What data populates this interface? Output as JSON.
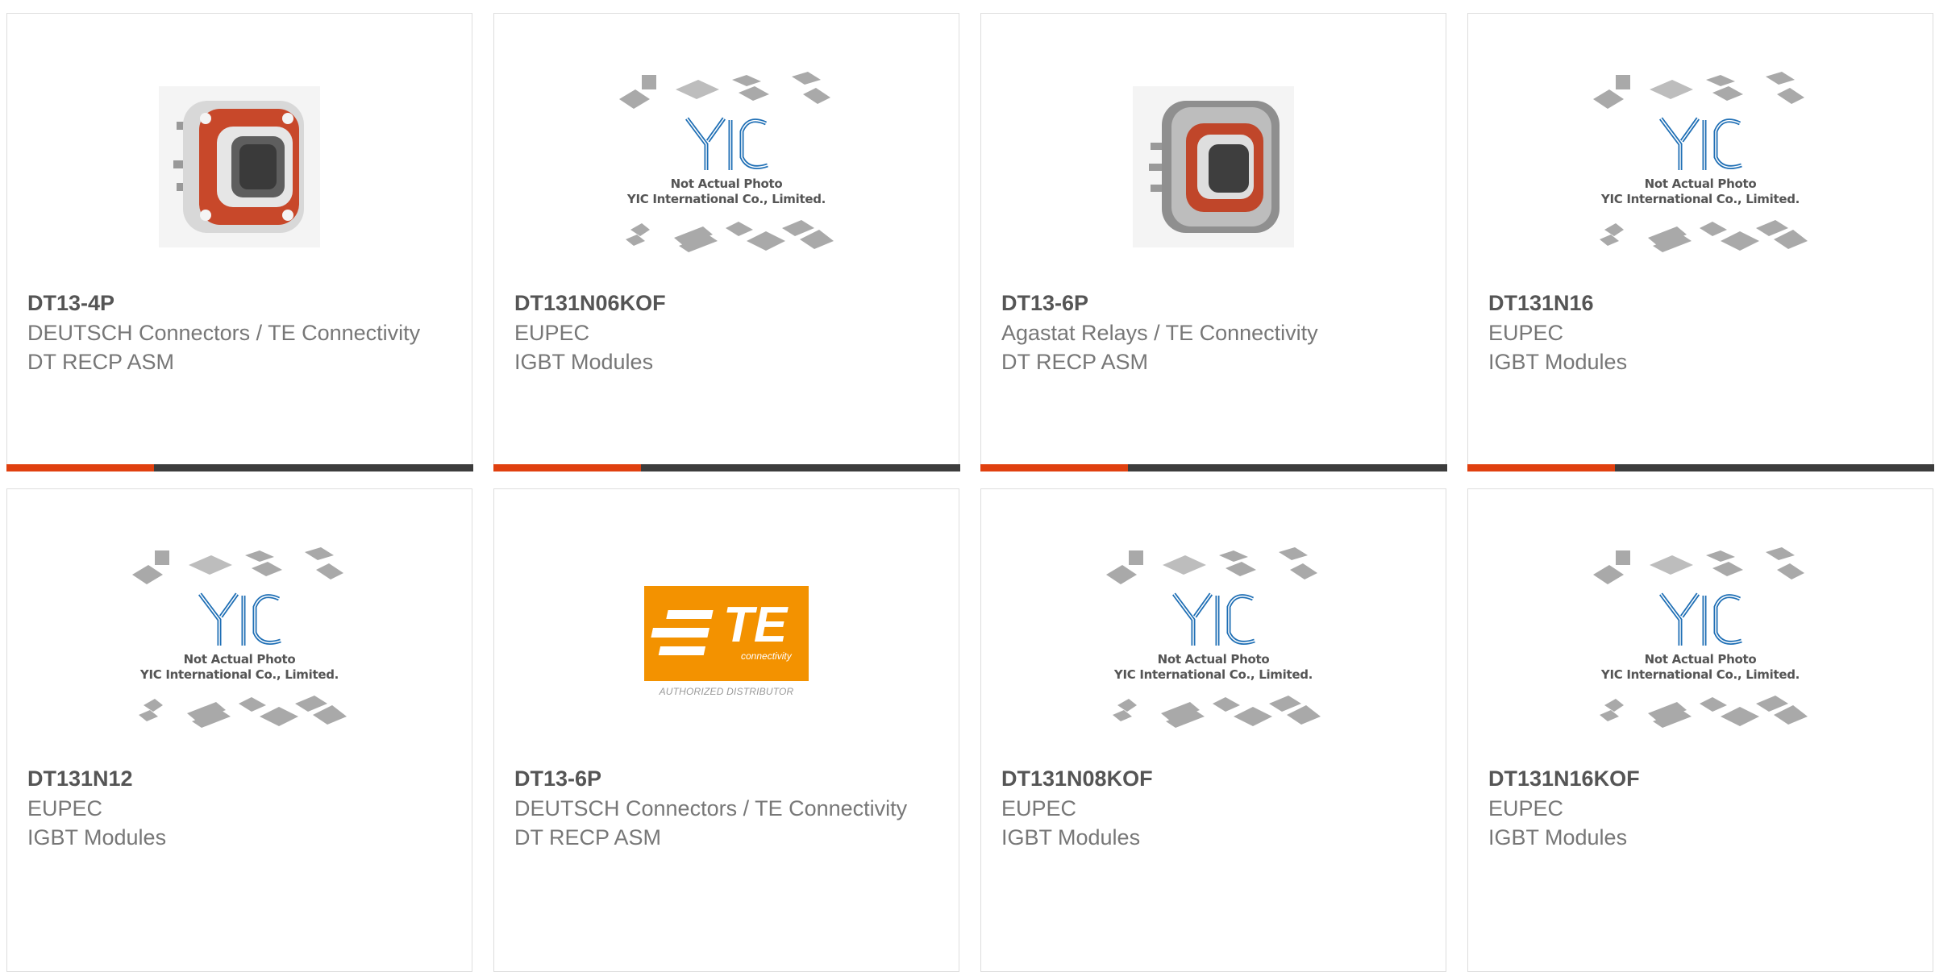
{
  "products": [
    {
      "part_number": "DT13-4P",
      "manufacturer": "DEUTSCH Connectors / TE Connectivity",
      "description": "DT RECP ASM",
      "image": "connector-photo-orange"
    },
    {
      "part_number": "DT131N06KOF",
      "manufacturer": "EUPEC",
      "description": "IGBT Modules",
      "image": "yic-placeholder"
    },
    {
      "part_number": "DT13-6P",
      "manufacturer": "Agastat Relays / TE Connectivity",
      "description": "DT RECP ASM",
      "image": "connector-photo-gray"
    },
    {
      "part_number": "DT131N16",
      "manufacturer": "EUPEC",
      "description": "IGBT Modules",
      "image": "yic-placeholder"
    },
    {
      "part_number": "DT131N12",
      "manufacturer": "EUPEC",
      "description": "IGBT Modules",
      "image": "yic-placeholder"
    },
    {
      "part_number": "DT13-6P",
      "manufacturer": "DEUTSCH Connectors / TE Connectivity",
      "description": "DT RECP ASM",
      "image": "te-connectivity-logo"
    },
    {
      "part_number": "DT131N08KOF",
      "manufacturer": "EUPEC",
      "description": "IGBT Modules",
      "image": "yic-placeholder"
    },
    {
      "part_number": "DT131N16KOF",
      "manufacturer": "EUPEC",
      "description": "IGBT Modules",
      "image": "yic-placeholder"
    }
  ],
  "placeholder": {
    "line1": "Not Actual Photo",
    "line2": "YIC International Co., Limited.",
    "logo_text": "YIC"
  },
  "te_logo": {
    "text": "TE",
    "subtext": "connectivity",
    "caption": "AUTHORIZED DISTRIBUTOR"
  },
  "colors": {
    "accent": "#e0400f",
    "bar": "#3c3c3c",
    "yic_blue": "#1f6fb5",
    "te_orange": "#f39200"
  }
}
